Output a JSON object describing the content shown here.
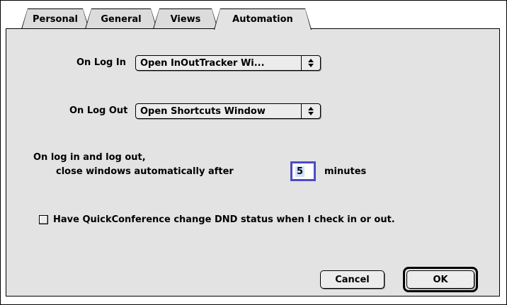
{
  "tabs": [
    {
      "label": "Personal"
    },
    {
      "label": "General"
    },
    {
      "label": "Views"
    },
    {
      "label": "Automation"
    }
  ],
  "automation": {
    "on_log_in_label": "On Log In",
    "on_log_in_value": "Open InOutTracker Wi...",
    "on_log_out_label": "On Log Out",
    "on_log_out_value": "Open Shortcuts Window",
    "close_text_line1": "On log in and log out,",
    "close_text_line2": "close windows automatically after",
    "minutes_value": "5",
    "minutes_label": "minutes",
    "dnd_checkbox_label": "Have QuickConference change DND status when I check in or out.",
    "dnd_checked": false
  },
  "buttons": {
    "cancel": "Cancel",
    "ok": "OK"
  },
  "icons": {
    "popup_arrows": "updown-arrows-icon"
  }
}
